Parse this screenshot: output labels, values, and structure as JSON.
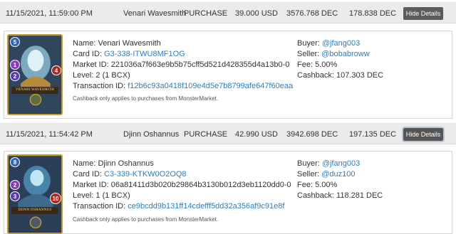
{
  "transactions": [
    {
      "date": "11/15/2021, 11:59:00 PM",
      "name": "Venari Wavesmith",
      "type": "PURCHASE",
      "price": "39.000 USD",
      "dec": "3576.768 DEC",
      "cashback": "178.838 DEC",
      "hide_label": "Hide Details",
      "card": {
        "banner": "VENARI WAVESMITH",
        "mana": "5",
        "attack": "1",
        "speed": "2",
        "health": "4",
        "colors": {
          "mana": "#2f63b8",
          "attack": "#8a3cb8",
          "speed": "#5a3cb0",
          "health": "#b3261e",
          "border": "#c49a2c"
        }
      },
      "details": {
        "name_label": "Name: ",
        "name": "Venari Wavesmith",
        "card_label": "Card ID: ",
        "card_id": "G3-338-ITWU8MF1OG",
        "market_label": "Market ID: ",
        "market_id": "221036a7f663e9b5b75cff5d521d428355d4a13b0-0",
        "level": "Level: 2 (1 BCX)",
        "tx_label": "Transaction ID: ",
        "tx_id": "f12b6c93a0418f109e4d5e7b8799afe647f60eaa",
        "buyer_label": "Buyer: ",
        "buyer": "@jfang003",
        "seller_label": "Seller: ",
        "seller": "@bobabroww",
        "fee": "Fee: 5.00%",
        "cashback": "Cashback: 107.303 DEC",
        "note": "Cashback only applies to purchases from MonsterMarket."
      }
    },
    {
      "date": "11/15/2021, 11:54:42 PM",
      "name": "Djinn Oshannus",
      "type": "PURCHASE",
      "price": "42.990 USD",
      "dec": "3942.698 DEC",
      "cashback": "197.135 DEC",
      "hide_label": "Hide Details",
      "card": {
        "banner": "DJINN OSHANNUS",
        "mana": "8",
        "attack": "3",
        "speed": "2",
        "health": "10",
        "colors": {
          "mana": "#2f63b8",
          "attack": "#8a3cb8",
          "speed": "#5a3cb0",
          "health": "#b3261e",
          "border": "#c49a2c"
        }
      },
      "details": {
        "name_label": "Name: ",
        "name": "Djinn Oshannus",
        "card_label": "Card ID: ",
        "card_id": "C3-339-KTKW0O2OQ8",
        "market_label": "Market ID: ",
        "market_id": "06a81411d3b020b29864b3130b012d3eb1120dd0-0",
        "level": "Level: 1 (1 BCX)",
        "tx_label": "Transaction ID: ",
        "tx_id": "ce9bcdd9b131ff14cdefff5dd32a356af9c91e8f",
        "buyer_label": "Buyer: ",
        "buyer": "@jfang003",
        "seller_label": "Seller: ",
        "seller": "@duz100",
        "fee": "Fee: 5.00%",
        "cashback": "Cashback: 118.281 DEC",
        "note": "Cashback only applies to purchases from MonsterMarket."
      }
    }
  ]
}
